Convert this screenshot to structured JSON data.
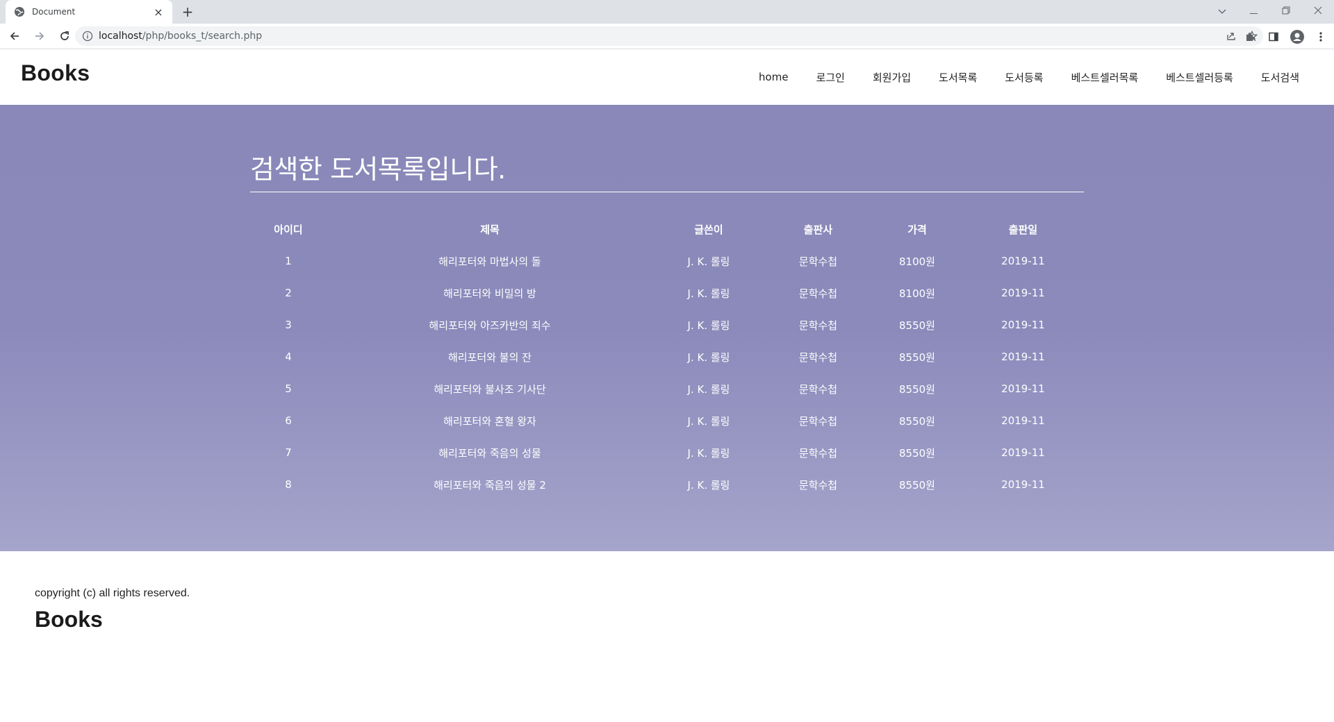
{
  "browser": {
    "tab_title": "Document",
    "tab_close": "×",
    "new_tab": "+",
    "url_host": "localhost",
    "url_path": "/php/books_t/search.php"
  },
  "site": {
    "brand": "Books",
    "nav": [
      "home",
      "로그인",
      "회원가입",
      "도서목록",
      "도서등록",
      "베스트셀러목록",
      "베스트셀러등록",
      "도서검색"
    ]
  },
  "main": {
    "heading": "검색한 도서목록입니다.",
    "columns": [
      "아이디",
      "제목",
      "글쓴이",
      "출판사",
      "가격",
      "출판일"
    ],
    "rows": [
      [
        "1",
        "해리포터와 마법사의 돌",
        "J. K. 롤링",
        "문학수첩",
        "8100원",
        "2019-11"
      ],
      [
        "2",
        "해리포터와 비밀의 방",
        "J. K. 롤링",
        "문학수첩",
        "8100원",
        "2019-11"
      ],
      [
        "3",
        "해리포터와 아즈카반의 죄수",
        "J. K. 롤링",
        "문학수첩",
        "8550원",
        "2019-11"
      ],
      [
        "4",
        "해리포터와 불의 잔",
        "J. K. 롤링",
        "문학수첩",
        "8550원",
        "2019-11"
      ],
      [
        "5",
        "해리포터와 불사조 기사단",
        "J. K. 롤링",
        "문학수첩",
        "8550원",
        "2019-11"
      ],
      [
        "6",
        "해리포터와 혼혈 왕자",
        "J. K. 롤링",
        "문학수첩",
        "8550원",
        "2019-11"
      ],
      [
        "7",
        "해리포터와 죽음의 성물",
        "J. K. 롤링",
        "문학수첩",
        "8550원",
        "2019-11"
      ],
      [
        "8",
        "해리포터와 죽음의 성물 2",
        "J. K. 롤링",
        "문학수첩",
        "8550원",
        "2019-11"
      ]
    ]
  },
  "footer": {
    "copyright": "copyright (c) all rights reserved.",
    "brand": "Books"
  },
  "colors": {
    "hero_top": "#8988b8",
    "hero_bottom": "#a5a4cb",
    "text_on_hero": "#ffffff"
  }
}
